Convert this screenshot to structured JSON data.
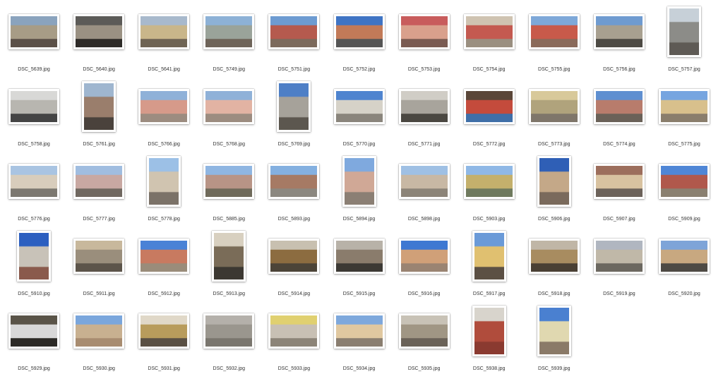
{
  "files": [
    {
      "name": "DSC_5639.jpg",
      "orientation": "landscape",
      "palette": [
        "#8aa3bd",
        "#a79c86",
        "#5b5048"
      ]
    },
    {
      "name": "DSC_5640.jpg",
      "orientation": "landscape",
      "palette": [
        "#5c5b58",
        "#9a9183",
        "#2e2b28"
      ]
    },
    {
      "name": "DSC_5641.jpg",
      "orientation": "landscape",
      "palette": [
        "#a8b9cc",
        "#c9b68a",
        "#6f6454"
      ]
    },
    {
      "name": "DSC_5749.jpg",
      "orientation": "landscape",
      "palette": [
        "#8db1d6",
        "#9aa39a",
        "#6e6459"
      ]
    },
    {
      "name": "DSC_5751.jpg",
      "orientation": "landscape",
      "palette": [
        "#6d9bd1",
        "#b55a4e",
        "#7c6a5c"
      ]
    },
    {
      "name": "DSC_5752.jpg",
      "orientation": "landscape",
      "palette": [
        "#3f74c4",
        "#c27a58",
        "#555555"
      ]
    },
    {
      "name": "DSC_5753.jpg",
      "orientation": "landscape",
      "palette": [
        "#c85c5c",
        "#d9a08c",
        "#7a5b52"
      ]
    },
    {
      "name": "DSC_5754.jpg",
      "orientation": "landscape",
      "palette": [
        "#cfc3b1",
        "#c45a50",
        "#9a8f80"
      ]
    },
    {
      "name": "DSC_5755.jpg",
      "orientation": "landscape",
      "palette": [
        "#7ea8d8",
        "#c85a4a",
        "#8a6a5a"
      ]
    },
    {
      "name": "DSC_5756.jpg",
      "orientation": "landscape",
      "palette": [
        "#6f9bd0",
        "#a8a090",
        "#4d4a44"
      ]
    },
    {
      "name": "DSC_5757.jpg",
      "orientation": "portrait",
      "palette": [
        "#c7d0d8",
        "#8c8c88",
        "#5e5a55"
      ]
    },
    {
      "name": "DSC_5758.jpg",
      "orientation": "landscape",
      "palette": [
        "#d8d8d6",
        "#b8b6b0",
        "#444444"
      ]
    },
    {
      "name": "DSC_5761.jpg",
      "orientation": "portrait",
      "palette": [
        "#9fb6cf",
        "#9a7e6c",
        "#4a423c"
      ]
    },
    {
      "name": "DSC_5766.jpg",
      "orientation": "landscape",
      "palette": [
        "#8fb1d8",
        "#d69a8a",
        "#9c8c80"
      ]
    },
    {
      "name": "DSC_5768.jpg",
      "orientation": "landscape",
      "palette": [
        "#8fb1d8",
        "#e2b3a3",
        "#9c8c80"
      ]
    },
    {
      "name": "DSC_5769.jpg",
      "orientation": "portrait",
      "palette": [
        "#4e7fc6",
        "#a6a29a",
        "#5c574f"
      ]
    },
    {
      "name": "DSC_5770.jpg",
      "orientation": "landscape",
      "palette": [
        "#4f84cf",
        "#d6d2c8",
        "#8a857c"
      ]
    },
    {
      "name": "DSC_5771.jpg",
      "orientation": "landscape",
      "palette": [
        "#d0cdc6",
        "#a8a49c",
        "#4a4741"
      ]
    },
    {
      "name": "DSC_5772.jpg",
      "orientation": "landscape",
      "palette": [
        "#5a4638",
        "#c44b3c",
        "#3f6fa8"
      ]
    },
    {
      "name": "DSC_5773.jpg",
      "orientation": "landscape",
      "palette": [
        "#d8c99a",
        "#b0a37c",
        "#7f766a"
      ]
    },
    {
      "name": "DSC_5774.jpg",
      "orientation": "landscape",
      "palette": [
        "#5f8fd0",
        "#b87c6c",
        "#6a6158"
      ]
    },
    {
      "name": "DSC_5775.jpg",
      "orientation": "landscape",
      "palette": [
        "#76a5e0",
        "#d8c08c",
        "#8a7e6c"
      ]
    },
    {
      "name": "DSC_5776.jpg",
      "orientation": "landscape",
      "palette": [
        "#a9c4e2",
        "#d8cdbc",
        "#7c7870"
      ]
    },
    {
      "name": "DSC_5777.jpg",
      "orientation": "landscape",
      "palette": [
        "#a0bde0",
        "#c8a8a2",
        "#706860"
      ]
    },
    {
      "name": "DSC_5778.jpg",
      "orientation": "portrait",
      "palette": [
        "#9cc0e6",
        "#d0c4b0",
        "#7b7268"
      ]
    },
    {
      "name": "DSC_5885.jpg",
      "orientation": "landscape",
      "palette": [
        "#8fb6e2",
        "#b89486",
        "#6f6a5a"
      ]
    },
    {
      "name": "DSC_5893.jpg",
      "orientation": "landscape",
      "palette": [
        "#84b0e0",
        "#a67a64",
        "#8c8880"
      ]
    },
    {
      "name": "DSC_5894.jpg",
      "orientation": "portrait",
      "palette": [
        "#7fa9de",
        "#d0a896",
        "#8b7f74"
      ]
    },
    {
      "name": "DSC_5898.jpg",
      "orientation": "landscape",
      "palette": [
        "#9fc0e4",
        "#c8b8a4",
        "#8c8478"
      ]
    },
    {
      "name": "DSC_5903.jpg",
      "orientation": "landscape",
      "palette": [
        "#8fb8e6",
        "#c4b06c",
        "#6f7a5e"
      ]
    },
    {
      "name": "DSC_5906.jpg",
      "orientation": "portrait",
      "palette": [
        "#2f5fb6",
        "#c4a888",
        "#7a6a5c"
      ]
    },
    {
      "name": "DSC_5907.jpg",
      "orientation": "landscape",
      "palette": [
        "#9c6e5c",
        "#d8c2a0",
        "#6c625a"
      ]
    },
    {
      "name": "DSC_5909.jpg",
      "orientation": "landscape",
      "palette": [
        "#4f86d6",
        "#b0584c",
        "#8a8070"
      ]
    },
    {
      "name": "DSC_5910.jpg",
      "orientation": "portrait",
      "palette": [
        "#2c5fc0",
        "#c8c2b8",
        "#8a5a4c"
      ]
    },
    {
      "name": "DSC_5911.jpg",
      "orientation": "landscape",
      "palette": [
        "#c8b89c",
        "#9a8e7c",
        "#5c544a"
      ]
    },
    {
      "name": "DSC_5912.jpg",
      "orientation": "landscape",
      "palette": [
        "#4a82d6",
        "#c87a60",
        "#9a8c7a"
      ]
    },
    {
      "name": "DSC_5913.jpg",
      "orientation": "portrait",
      "palette": [
        "#d8d0c0",
        "#7a6c58",
        "#3c3832"
      ]
    },
    {
      "name": "DSC_5914.jpg",
      "orientation": "landscape",
      "palette": [
        "#c8c0b0",
        "#8c6c40",
        "#4c4438"
      ]
    },
    {
      "name": "DSC_5915.jpg",
      "orientation": "landscape",
      "palette": [
        "#b8b2a8",
        "#8a7c6c",
        "#3c3934"
      ]
    },
    {
      "name": "DSC_5916.jpg",
      "orientation": "landscape",
      "palette": [
        "#3e78d2",
        "#d0a078",
        "#9a8472"
      ]
    },
    {
      "name": "DSC_5917.jpg",
      "orientation": "portrait",
      "palette": [
        "#6a9ad8",
        "#e0c070",
        "#5c5044"
      ]
    },
    {
      "name": "DSC_5918.jpg",
      "orientation": "landscape",
      "palette": [
        "#c0b6a6",
        "#a88c60",
        "#4a4034"
      ]
    },
    {
      "name": "DSC_5919.jpg",
      "orientation": "landscape",
      "palette": [
        "#b0b6c0",
        "#c0b8a8",
        "#6c6860"
      ]
    },
    {
      "name": "DSC_5920.jpg",
      "orientation": "landscape",
      "palette": [
        "#7ea4d8",
        "#c8a880",
        "#4e4a44"
      ]
    },
    {
      "name": "DSC_5929.jpg",
      "orientation": "landscape",
      "palette": [
        "#5a5448",
        "#d8d8d8",
        "#2c2a26"
      ]
    },
    {
      "name": "DSC_5930.jpg",
      "orientation": "landscape",
      "palette": [
        "#7aa6dc",
        "#c8b090",
        "#a88c70"
      ]
    },
    {
      "name": "DSC_5931.jpg",
      "orientation": "landscape",
      "palette": [
        "#e0d8c8",
        "#b89c5c",
        "#5a5044"
      ]
    },
    {
      "name": "DSC_5932.jpg",
      "orientation": "landscape",
      "palette": [
        "#b4b0aa",
        "#9a968e",
        "#7a766e"
      ]
    },
    {
      "name": "DSC_5933.jpg",
      "orientation": "landscape",
      "palette": [
        "#e0d070",
        "#c8c0b4",
        "#8c8478"
      ]
    },
    {
      "name": "DSC_5934.jpg",
      "orientation": "landscape",
      "palette": [
        "#7ea8dc",
        "#e0c8a0",
        "#8a7e70"
      ]
    },
    {
      "name": "DSC_5935.jpg",
      "orientation": "landscape",
      "palette": [
        "#c8c2b6",
        "#a09684",
        "#6a6258"
      ]
    },
    {
      "name": "DSC_5938.jpg",
      "orientation": "portrait",
      "palette": [
        "#d8d4cc",
        "#b04c3c",
        "#8a3a30"
      ]
    },
    {
      "name": "DSC_5939.jpg",
      "orientation": "portrait",
      "palette": [
        "#4a80d0",
        "#e0d8b0",
        "#8a7a68"
      ]
    }
  ]
}
